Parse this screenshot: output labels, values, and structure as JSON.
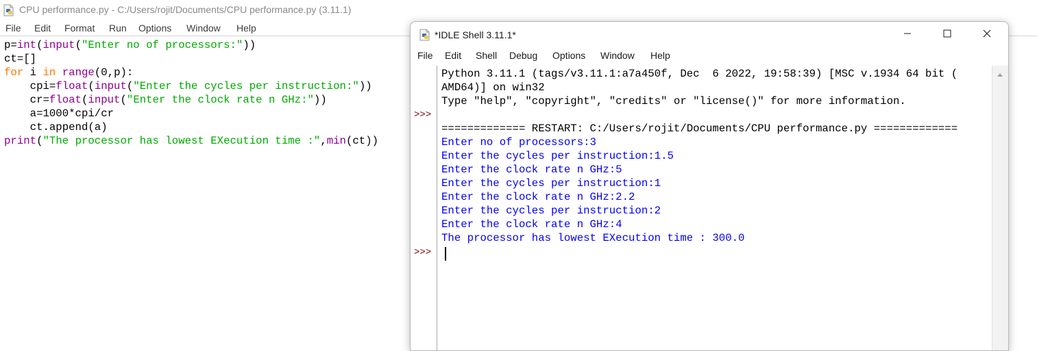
{
  "editor": {
    "title": "CPU performance.py - C:/Users/rojit/Documents/CPU performance.py (3.11.1)",
    "menu": [
      "File",
      "Edit",
      "Format",
      "Run",
      "Options",
      "Window",
      "Help"
    ],
    "code": {
      "l1": {
        "a": "p=",
        "b": "int",
        "c": "(",
        "d": "input",
        "e": "(",
        "f": "\"Enter no of processors:\"",
        "g": "))"
      },
      "l2": "ct=[]",
      "l3": {
        "a": "for",
        "b": " i ",
        "c": "in",
        "d": " ",
        "e": "range",
        "f": "(0,p):"
      },
      "l4": {
        "a": "    cpi=",
        "b": "float",
        "c": "(",
        "d": "input",
        "e": "(",
        "f": "\"Enter the cycles per instruction:\"",
        "g": "))"
      },
      "l5": {
        "a": "    cr=",
        "b": "float",
        "c": "(",
        "d": "input",
        "e": "(",
        "f": "\"Enter the clock rate n GHz:\"",
        "g": "))"
      },
      "l6": "    a=1000*cpi/cr",
      "l7": "    ct.append(a)",
      "l8": {
        "a": "print",
        "b": "(",
        "c": "\"The processor has lowest EXecution time :\"",
        "d": ",",
        "e": "min",
        "f": "(ct))"
      }
    }
  },
  "shell": {
    "title": "*IDLE Shell 3.11.1*",
    "menu": [
      "File",
      "Edit",
      "Shell",
      "Debug",
      "Options",
      "Window",
      "Help"
    ],
    "prompt": ">>>",
    "banner": [
      "Python 3.11.1 (tags/v3.11.1:a7a450f, Dec  6 2022, 19:58:39) [MSC v.1934 64 bit (",
      "AMD64)] on win32",
      "Type \"help\", \"copyright\", \"credits\" or \"license()\" for more information."
    ],
    "restart": "============= RESTART: C:/Users/rojit/Documents/CPU performance.py =============",
    "output": [
      "Enter no of processors:3",
      "Enter the cycles per instruction:1.5",
      "Enter the clock rate n GHz:5",
      "Enter the cycles per instruction:1",
      "Enter the clock rate n GHz:2.2",
      "Enter the cycles per instruction:2",
      "Enter the clock rate n GHz:4",
      "The processor has lowest EXecution time : 300.0"
    ]
  },
  "icons": {
    "python_file": "python-file-icon",
    "minimize": "minimize-icon",
    "maximize": "maximize-icon",
    "close": "close-icon",
    "scroll_up": "scroll-up-arrow-icon"
  },
  "colors": {
    "keyword": "#ff7700",
    "builtin": "#900090",
    "string": "#00aa00",
    "output": "#0000ff",
    "prompt": "#7a0000"
  }
}
